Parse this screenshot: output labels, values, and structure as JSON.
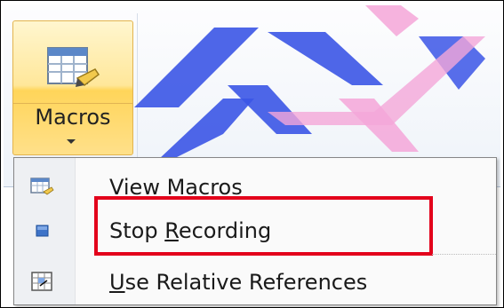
{
  "ribbon": {
    "macros_button": {
      "label": "Macros",
      "icon": "macros-icon",
      "dropdown_icon": "chevron-down-icon"
    }
  },
  "menu": {
    "items": [
      {
        "label_before": "",
        "accel": "V",
        "label_after": "iew Macros",
        "icon": "view-macros-icon"
      },
      {
        "label_before": "Stop ",
        "accel": "R",
        "label_after": "ecording",
        "icon": "stop-recording-icon",
        "highlighted": true
      },
      {
        "label_before": "",
        "accel": "U",
        "label_after": "se Relative References",
        "icon": "relative-references-icon"
      }
    ]
  },
  "colors": {
    "highlight_border": "#e3001b",
    "button_hover": "#ffe79a",
    "watermark_blue": "#3b55e6",
    "watermark_pink": "#f4a6d8"
  }
}
